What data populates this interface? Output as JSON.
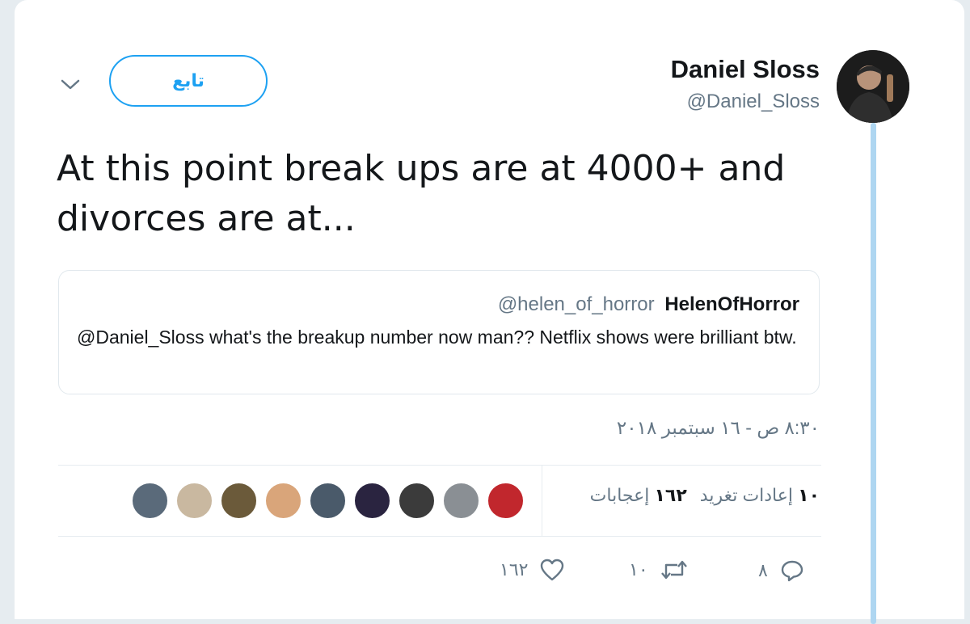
{
  "author": {
    "name": "Daniel Sloss",
    "handle": "@Daniel_Sloss"
  },
  "follow_label": "تابع",
  "tweet_text": "At this point break ups are at 4000+ and divorces are at...",
  "quoted": {
    "handle": "@helen_of_horror",
    "name": "HelenOfHorror",
    "text": "@Daniel_Sloss what's the breakup number now man?? Netflix shows were brilliant btw."
  },
  "timestamp": "٨:٣٠ ص - ١٦ سبتمبر ٢٠١٨",
  "stats": {
    "retweets_count": "١٠",
    "retweets_label": "إعادات تغريد",
    "likes_count": "١٦٢",
    "likes_label": "إعجابات"
  },
  "likers": [
    {
      "color": "#c1272d"
    },
    {
      "color": "#8a8f94"
    },
    {
      "color": "#3b3b3b"
    },
    {
      "color": "#2a2440"
    },
    {
      "color": "#4a5a6a"
    },
    {
      "color": "#d9a57a"
    },
    {
      "color": "#6b5a3a"
    },
    {
      "color": "#c9b8a0"
    },
    {
      "color": "#5a6a7a"
    }
  ],
  "actions": {
    "replies": "٨",
    "retweets": "١٠",
    "likes": "١٦٢"
  },
  "colors": {
    "accent": "#1da1f2",
    "thread_line": "#aed6f1"
  }
}
